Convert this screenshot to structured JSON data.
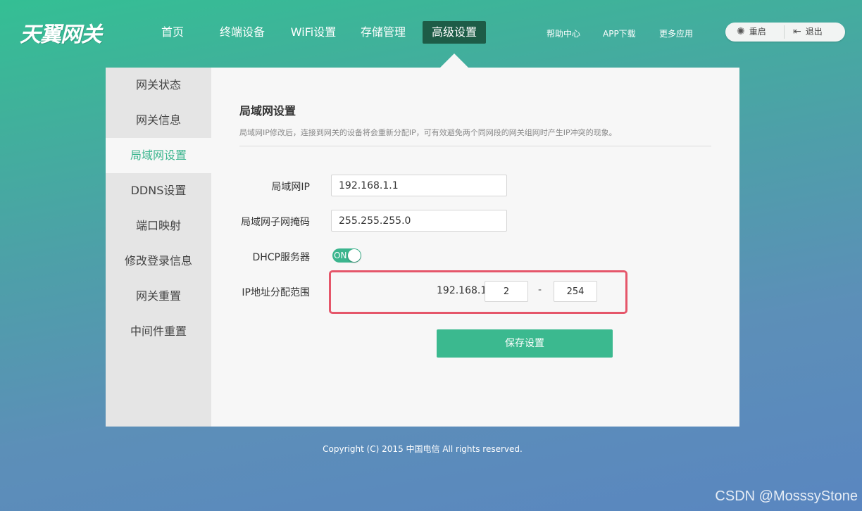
{
  "header": {
    "logo": "天翼网关",
    "nav": [
      "首页",
      "终端设备",
      "WiFi设置",
      "存储管理",
      "高级设置"
    ],
    "active_nav": "高级设置",
    "top_links": [
      "帮助中心",
      "APP下载",
      "更多应用"
    ],
    "restart_label": "重启",
    "logout_label": "退出"
  },
  "sidebar": {
    "items": [
      "网关状态",
      "网关信息",
      "局域网设置",
      "DDNS设置",
      "端口映射",
      "修改登录信息",
      "网关重置",
      "中间件重置"
    ],
    "active": "局域网设置"
  },
  "lan": {
    "title": "局域网设置",
    "description": "局域网IP修改后，连接到网关的设备将会重新分配IP，可有效避免两个同网段的网关组网时产生IP冲突的现象。",
    "ip_label": "局域网IP",
    "ip_value": "192.168.1.1",
    "mask_label": "局域网子网掩码",
    "mask_value": "255.255.255.0",
    "dhcp_label": "DHCP服务器",
    "dhcp_state": "ON",
    "range_label": "IP地址分配范围",
    "range_prefix": "192.168.1.",
    "range_start": "2",
    "range_end": "254",
    "range_separator": "-",
    "save_label": "保存设置"
  },
  "colors": {
    "accent": "#3bb58e",
    "nav_active_bg": "#1d5c47",
    "highlight_border": "#e5566a"
  },
  "footer": "Copyright (C) 2015 中国电信 All rights reserved.",
  "watermark": "CSDN @MosssyStone"
}
